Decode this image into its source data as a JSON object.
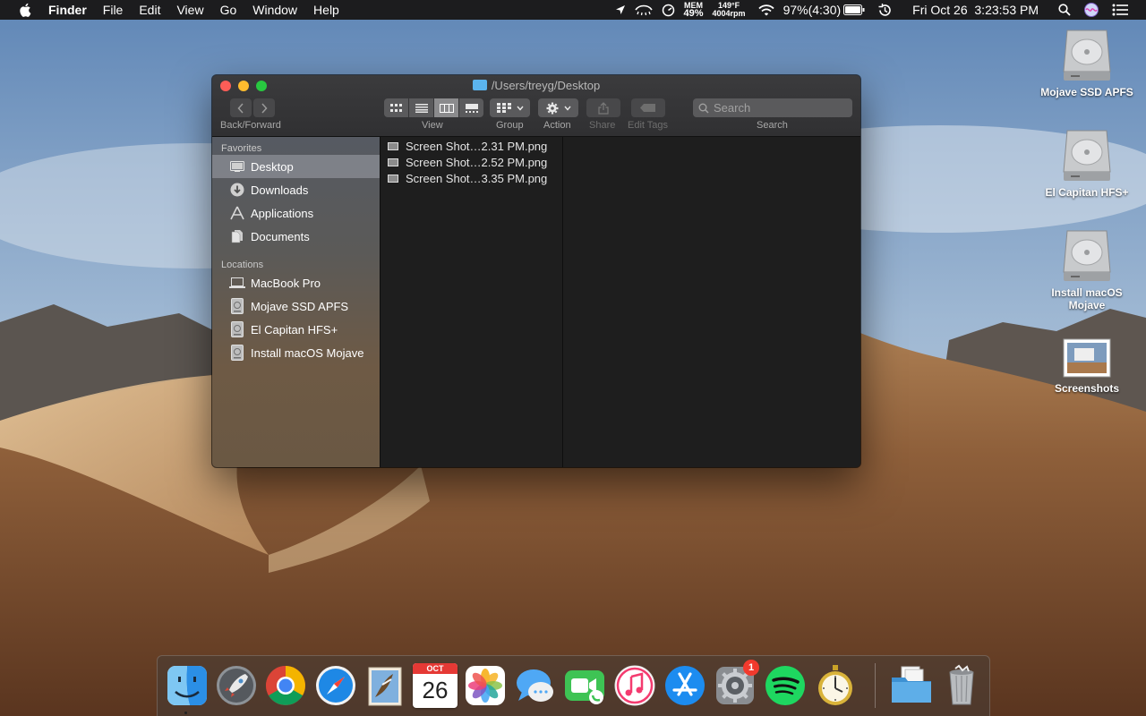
{
  "menubar": {
    "app_name": "Finder",
    "menus": [
      "File",
      "Edit",
      "View",
      "Go",
      "Window",
      "Help"
    ],
    "mem_label": "MEM",
    "mem_value": "49%",
    "temp": "149°F",
    "fan": "4004rpm",
    "battery": "97%(4:30)",
    "clock": "Fri Oct 26  3:23:53 PM",
    "icons": [
      "apple-icon",
      "location-arrow-icon",
      "eye-icon",
      "speed-gauge-icon",
      "wifi-icon",
      "battery-icon",
      "time-machine-icon",
      "spotlight-icon",
      "siri-icon",
      "notification-center-icon"
    ]
  },
  "desktop_icons": [
    {
      "label": "Mojave SSD APFS",
      "icon": "hard-drive-icon"
    },
    {
      "label": "El Capitan HFS+",
      "icon": "hard-drive-icon"
    },
    {
      "label": "Install macOS Mojave",
      "icon": "hard-drive-icon"
    },
    {
      "label": "Screenshots",
      "icon": "screenshots-folder-icon"
    }
  ],
  "finder": {
    "title": "/Users/treyg/Desktop",
    "toolbar": {
      "back_forward_label": "Back/Forward",
      "view_label": "View",
      "group_label": "Group",
      "action_label": "Action",
      "share_label": "Share",
      "edit_tags_label": "Edit Tags",
      "search_label": "Search",
      "search_placeholder": "Search",
      "active_view": "columns"
    },
    "sidebar": {
      "favorites_header": "Favorites",
      "favorites": [
        {
          "label": "Desktop",
          "icon": "desktop-icon",
          "selected": true
        },
        {
          "label": "Downloads",
          "icon": "downloads-icon"
        },
        {
          "label": "Applications",
          "icon": "applications-icon"
        },
        {
          "label": "Documents",
          "icon": "documents-icon"
        }
      ],
      "locations_header": "Locations",
      "locations": [
        {
          "label": "MacBook Pro",
          "icon": "laptop-icon"
        },
        {
          "label": "Mojave SSD APFS",
          "icon": "disk-icon"
        },
        {
          "label": "El Capitan HFS+",
          "icon": "disk-icon"
        },
        {
          "label": "Install macOS Mojave",
          "icon": "disk-icon"
        }
      ]
    },
    "files": [
      "Screen Shot…2.31 PM.png",
      "Screen Shot…2.52 PM.png",
      "Screen Shot…3.35 PM.png"
    ]
  },
  "dock": {
    "apps": [
      {
        "name": "Finder",
        "icon": "finder-icon",
        "running": true
      },
      {
        "name": "Launchpad",
        "icon": "launchpad-icon"
      },
      {
        "name": "Chrome",
        "icon": "chrome-icon"
      },
      {
        "name": "Safari",
        "icon": "safari-icon"
      },
      {
        "name": "Mail",
        "icon": "mail-icon"
      },
      {
        "name": "Calendar",
        "icon": "calendar-icon",
        "month": "OCT",
        "day": "26"
      },
      {
        "name": "Photos",
        "icon": "photos-icon"
      },
      {
        "name": "Messages",
        "icon": "messages-icon"
      },
      {
        "name": "FaceTime",
        "icon": "facetime-icon"
      },
      {
        "name": "iTunes",
        "icon": "itunes-icon"
      },
      {
        "name": "App Store",
        "icon": "app-store-icon"
      },
      {
        "name": "System Preferences",
        "icon": "system-preferences-icon",
        "badge": "1"
      },
      {
        "name": "Spotify",
        "icon": "spotify-icon"
      },
      {
        "name": "Time Machine Clock",
        "icon": "stopwatch-icon"
      }
    ],
    "trailing": [
      {
        "name": "Downloads Stack",
        "icon": "folder-stack-icon"
      },
      {
        "name": "Trash",
        "icon": "trash-icon"
      }
    ]
  },
  "colors": {
    "menubar_bg": "#1c1c1e",
    "finder_bg": "#1e1e1e",
    "traffic_red": "#fd5d57",
    "traffic_yellow": "#febc2e",
    "traffic_green": "#28c840",
    "badge_red": "#f23a2d"
  }
}
